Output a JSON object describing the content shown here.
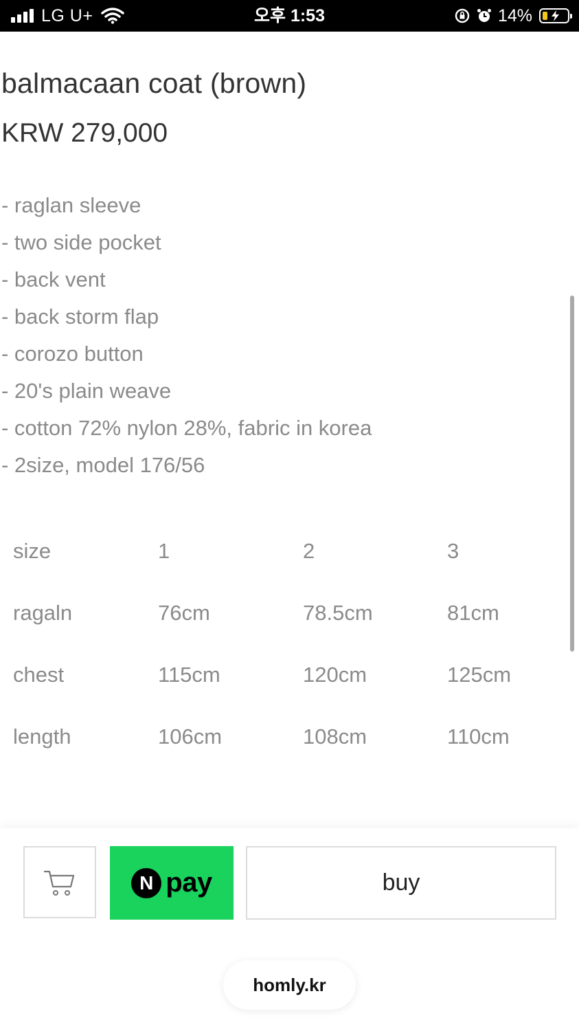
{
  "status_bar": {
    "carrier": "LG U+",
    "time": "오후 1:53",
    "battery": "14%",
    "icons": [
      "signal-icon",
      "wifi-icon",
      "rotation-lock-icon",
      "alarm-icon",
      "battery-charging-icon"
    ],
    "battery_color": "#f5c518"
  },
  "product": {
    "title": "balmacaan coat (brown)",
    "price": "KRW 279,000",
    "features": [
      "- raglan sleeve",
      "- two side pocket",
      "- back vent",
      "- back storm flap",
      "- corozo button",
      "- 20's plain weave",
      "- cotton 72% nylon 28%, fabric in korea",
      "- 2size, model 176/56"
    ]
  },
  "size_table": {
    "rows": [
      [
        "size",
        "1",
        "2",
        "3"
      ],
      [
        "ragaln",
        "76cm",
        "78.5cm",
        "81cm"
      ],
      [
        "chest",
        "115cm",
        "120cm",
        "125cm"
      ],
      [
        "length",
        "106cm",
        "108cm",
        "110cm"
      ]
    ]
  },
  "actions": {
    "cart_icon": "cart-icon",
    "npay_n": "N",
    "npay_text": "pay",
    "npay_color": "#19d35c",
    "buy_label": "buy"
  },
  "footer": {
    "site": "homly.kr"
  }
}
